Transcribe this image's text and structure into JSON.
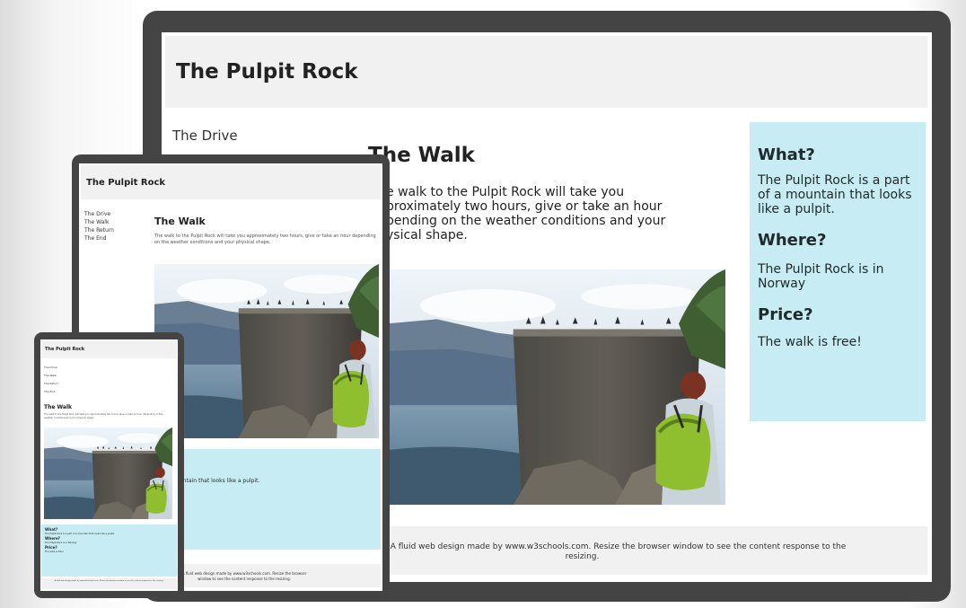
{
  "site": {
    "title": "The Pulpit Rock",
    "nav": [
      "The Drive",
      "The Walk",
      "The Return",
      "The End"
    ],
    "article_heading": "The Walk",
    "article_text": "The walk to the Pulpit Rock will take you approximately two hours, give or take an hour depending on the weather conditions and your physical shape.",
    "aside": [
      {
        "heading": "What?",
        "text": "The Pulpit Rock is a part of a mountain that looks like a pulpit."
      },
      {
        "heading": "Where?",
        "text": "The Pulpit Rock is in Norway"
      },
      {
        "heading": "Price?",
        "text": "The walk is free!"
      }
    ],
    "footer_text": "A fluid web design made by www.w3schools.com. Resize the browser window to see the content response to the resizing."
  },
  "desktop_clipped": {
    "walk_lines": [
      "e walk to the Pulpit Rock will take you",
      "proximately two hours, give or take an hour",
      "pending on the weather conditions and your",
      "ysical shape."
    ],
    "footer_lines": [
      "A fluid web design made by www.w3schools.com. Resize the browser window to see the content response to the",
      "resizing."
    ]
  },
  "tablet_clipped": {
    "aside_visible_text": "untain that looks like a pulpit."
  },
  "colors": {
    "frame": "#444444",
    "header_bg": "#f1f1f1",
    "aside_bg": "#c7ecf3"
  }
}
